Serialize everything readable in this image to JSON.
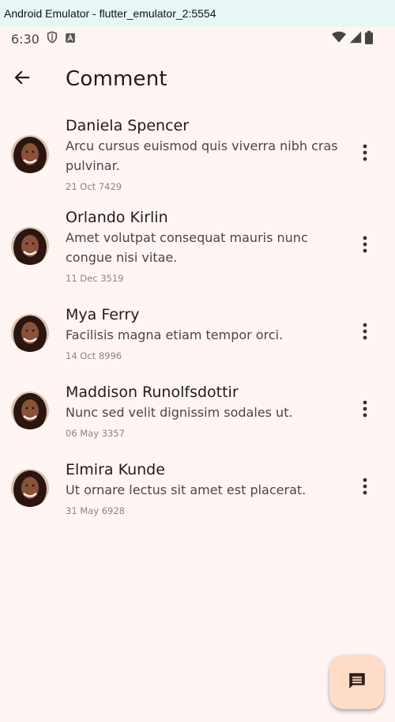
{
  "window": {
    "title": "Android Emulator - flutter_emulator_2:5554"
  },
  "status_bar": {
    "time": "6:30",
    "left_icons": [
      "shield-icon",
      "font-a-icon"
    ],
    "right_icons": [
      "wifi-icon",
      "signal-icon",
      "battery-icon"
    ]
  },
  "app_bar": {
    "title": "Comment",
    "back_icon": "arrow-back-icon"
  },
  "comments": [
    {
      "name": "Daniela Spencer",
      "text": "Arcu cursus euismod quis viverra nibh cras pulvinar.",
      "date": "21 Oct 7429"
    },
    {
      "name": "Orlando Kirlin",
      "text": "Amet volutpat consequat mauris nunc congue nisi vitae.",
      "date": "11 Dec 3519"
    },
    {
      "name": "Mya Ferry",
      "text": "Facilisis magna etiam tempor orci.",
      "date": "14 Oct 8996"
    },
    {
      "name": "Maddison Runolfsdottir",
      "text": "Nunc sed velit dignissim sodales ut.",
      "date": "06 May 3357"
    },
    {
      "name": "Elmira Kunde",
      "text": "Ut ornare lectus sit amet est placerat.",
      "date": "31 May 6928"
    }
  ],
  "fab": {
    "icon": "comment-icon"
  },
  "colors": {
    "background": "#fff6f3",
    "titlebar": "#e8f7f6",
    "fab": "#ffdcc8"
  }
}
